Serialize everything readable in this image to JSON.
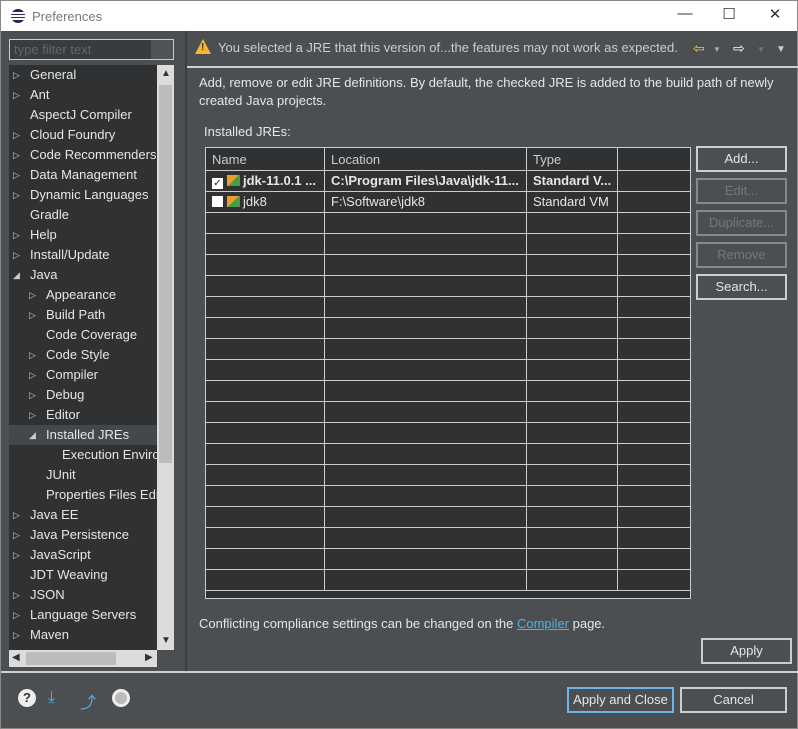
{
  "window": {
    "title": "Preferences",
    "min": "—",
    "max": "☐",
    "close": "✕"
  },
  "filter": {
    "placeholder": "type filter text"
  },
  "tree": [
    {
      "label": "General",
      "level": 0,
      "toggle": "closed"
    },
    {
      "label": "Ant",
      "level": 0,
      "toggle": "closed"
    },
    {
      "label": "AspectJ Compiler",
      "level": 0,
      "toggle": "none"
    },
    {
      "label": "Cloud Foundry",
      "level": 0,
      "toggle": "closed"
    },
    {
      "label": "Code Recommenders",
      "level": 0,
      "toggle": "closed"
    },
    {
      "label": "Data Management",
      "level": 0,
      "toggle": "closed"
    },
    {
      "label": "Dynamic Languages",
      "level": 0,
      "toggle": "closed"
    },
    {
      "label": "Gradle",
      "level": 0,
      "toggle": "none"
    },
    {
      "label": "Help",
      "level": 0,
      "toggle": "closed"
    },
    {
      "label": "Install/Update",
      "level": 0,
      "toggle": "closed"
    },
    {
      "label": "Java",
      "level": 0,
      "toggle": "open"
    },
    {
      "label": "Appearance",
      "level": 1,
      "toggle": "closed"
    },
    {
      "label": "Build Path",
      "level": 1,
      "toggle": "closed"
    },
    {
      "label": "Code Coverage",
      "level": 1,
      "toggle": "none"
    },
    {
      "label": "Code Style",
      "level": 1,
      "toggle": "closed"
    },
    {
      "label": "Compiler",
      "level": 1,
      "toggle": "closed"
    },
    {
      "label": "Debug",
      "level": 1,
      "toggle": "closed"
    },
    {
      "label": "Editor",
      "level": 1,
      "toggle": "closed"
    },
    {
      "label": "Installed JREs",
      "level": 1,
      "toggle": "open",
      "selected": true
    },
    {
      "label": "Execution Enviro",
      "level": 2,
      "toggle": "none"
    },
    {
      "label": "JUnit",
      "level": 1,
      "toggle": "none"
    },
    {
      "label": "Properties Files Edi",
      "level": 1,
      "toggle": "none"
    },
    {
      "label": "Java EE",
      "level": 0,
      "toggle": "closed"
    },
    {
      "label": "Java Persistence",
      "level": 0,
      "toggle": "closed"
    },
    {
      "label": "JavaScript",
      "level": 0,
      "toggle": "closed"
    },
    {
      "label": "JDT Weaving",
      "level": 0,
      "toggle": "none"
    },
    {
      "label": "JSON",
      "level": 0,
      "toggle": "closed"
    },
    {
      "label": "Language Servers",
      "level": 0,
      "toggle": "closed"
    },
    {
      "label": "Maven",
      "level": 0,
      "toggle": "closed"
    }
  ],
  "warning": "You selected a JRE that this version of...the features may not work as expected.",
  "description": "Add, remove or edit JRE definitions. By default, the checked JRE is added to the build path of newly created Java projects.",
  "installed_label": "Installed JREs:",
  "table": {
    "headers": [
      "Name",
      "Location",
      "Type",
      ""
    ],
    "rows": [
      {
        "checked": true,
        "name": "jdk-11.0.1 ...",
        "location": "C:\\Program Files\\Java\\jdk-11...",
        "type": "Standard V...",
        "bold": true
      },
      {
        "checked": false,
        "name": "jdk8",
        "location": "F:\\Software\\jdk8",
        "type": "Standard VM",
        "bold": false
      }
    ]
  },
  "buttons": {
    "add": "Add...",
    "edit": "Edit...",
    "duplicate": "Duplicate...",
    "remove": "Remove",
    "search": "Search...",
    "apply": "Apply",
    "apply_close": "Apply and Close",
    "cancel": "Cancel"
  },
  "note": {
    "before": "Conflicting compliance settings can be changed on the ",
    "link": "Compiler",
    "after": " page."
  }
}
